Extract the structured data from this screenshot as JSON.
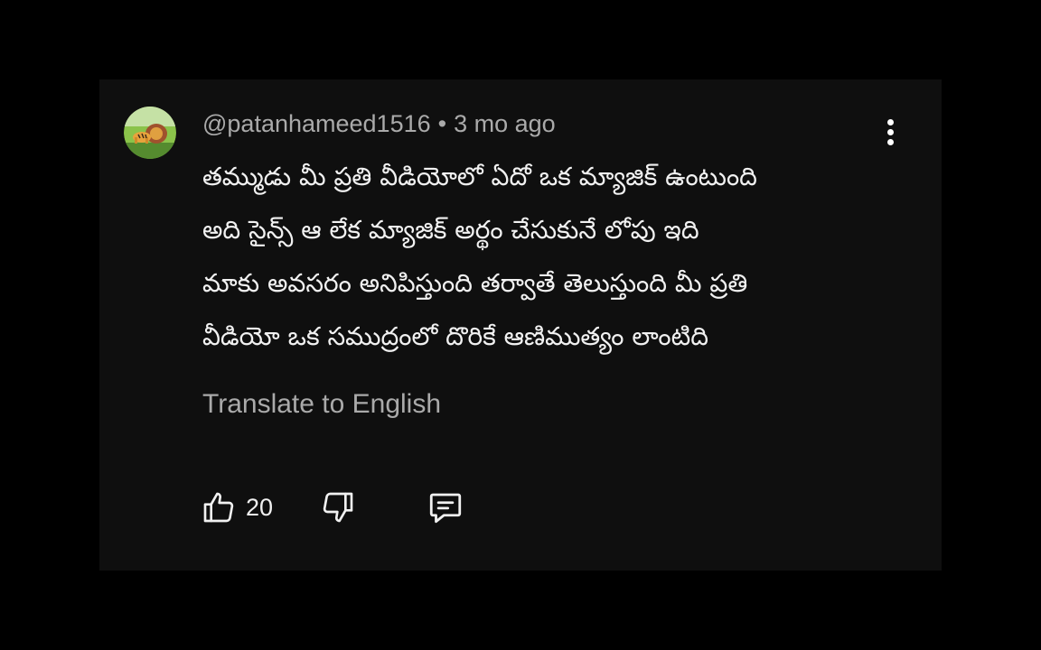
{
  "comment": {
    "author": "@patanhameed1516",
    "separator": "•",
    "time_ago": "3 mo ago",
    "text_lines": [
      "తమ్ముడు మీ ప్రతి వీడియోలో ఏదో ఒక మ్యాజిక్ ఉంటుంది",
      "అది సైన్స్ ఆ లేక మ్యాజిక్ అర్థం చేసుకునే లోపు ఇది",
      "మాకు అవసరం అనిపిస్తుంది తర్వాతే తెలుస్తుంది మీ ప్రతి",
      "వీడియో ఒక సముద్రంలో దొరికే ఆణిముత్యం లాంటిది"
    ],
    "translate_label": "Translate to English",
    "like_count": "20"
  },
  "icons": {
    "avatar": "lion-avatar",
    "more": "more-vertical-icon",
    "like": "thumbs-up-icon",
    "dislike": "thumbs-down-icon",
    "reply": "reply-comment-icon"
  },
  "colors": {
    "page_background": "#000000",
    "card_background": "#0f0f0f",
    "primary_text": "#f1f1f1",
    "secondary_text": "#aaaaaa"
  }
}
